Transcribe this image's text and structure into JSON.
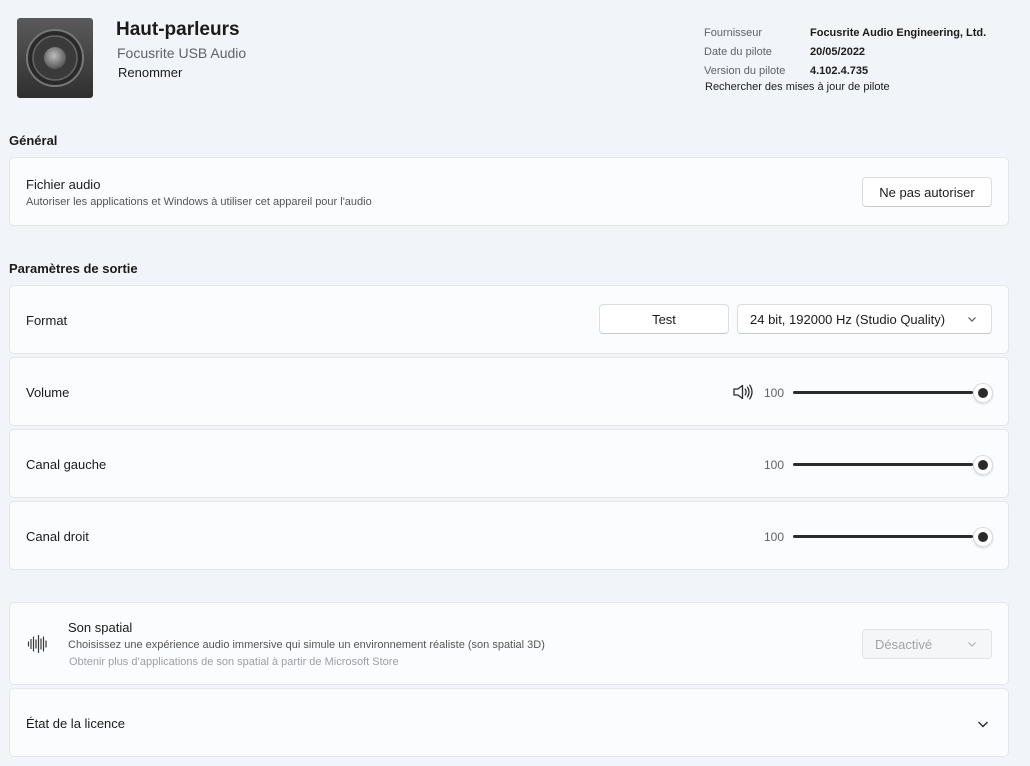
{
  "header": {
    "title": "Haut-parleurs",
    "subtitle": "Focusrite USB Audio",
    "rename": "Renommer",
    "info": {
      "supplier_label": "Fournisseur",
      "supplier_value": "Focusrite Audio Engineering, Ltd.",
      "date_label": "Date du pilote",
      "date_value": "20/05/2022",
      "version_label": "Version du pilote",
      "version_value": "4.102.4.735",
      "update_link": "Rechercher des mises à jour de pilote"
    }
  },
  "general": {
    "title": "Général",
    "audio_file": {
      "label": "Fichier audio",
      "description": "Autoriser les applications et Windows à utiliser cet appareil pour l'audio",
      "button": "Ne pas autoriser"
    }
  },
  "output": {
    "title": "Paramètres de sortie",
    "format": {
      "label": "Format",
      "test_button": "Test",
      "selected": "24 bit, 192000 Hz (Studio Quality)"
    },
    "volume": {
      "label": "Volume",
      "value": "100",
      "level": 1.0
    },
    "left": {
      "label": "Canal gauche",
      "value": "100",
      "level": 1.0
    },
    "right": {
      "label": "Canal droit",
      "value": "100",
      "level": 1.0
    }
  },
  "spatial": {
    "label": "Son spatial",
    "description": "Choisissez une expérience audio immersive qui simule un environnement réaliste (son spatial 3D)",
    "store_link": "Obtenir plus d’applications de son spatial à partir de Microsoft Store",
    "selected": "Désactivé"
  },
  "license": {
    "label": "État de la licence"
  },
  "icons": {
    "device": "speaker-device-icon",
    "volume": "speaker-volume-icon",
    "spatial": "spatial-audio-icon",
    "chevron": "chevron-down-icon"
  }
}
